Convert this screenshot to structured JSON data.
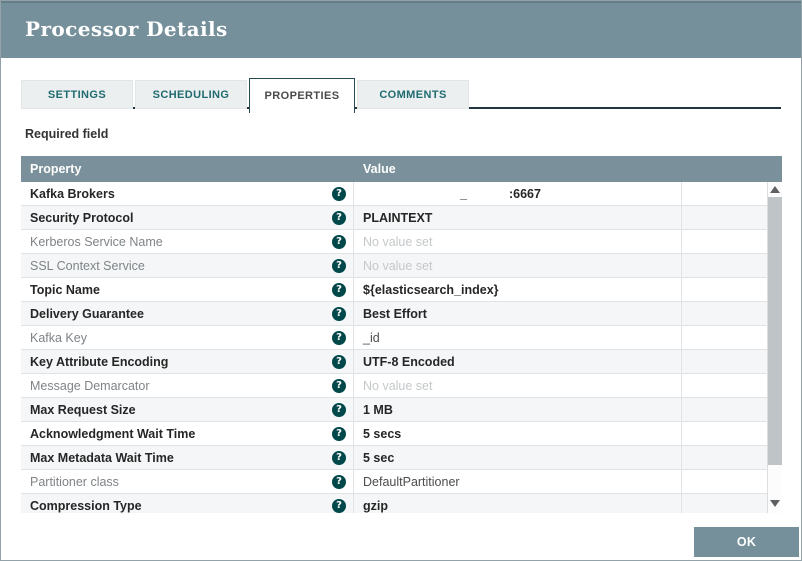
{
  "dialog": {
    "title": "Processor Details"
  },
  "tabs": [
    {
      "label": "SETTINGS",
      "active": false
    },
    {
      "label": "SCHEDULING",
      "active": false
    },
    {
      "label": "PROPERTIES",
      "active": true
    },
    {
      "label": "COMMENTS",
      "active": false
    }
  ],
  "required_field_label": "Required field",
  "ok_button_label": "OK",
  "help_icon_glyph": "?",
  "colors": {
    "header_slate": "#75909b",
    "dark_teal_icon": "#004849",
    "tab_teal_text": "#1f6b70",
    "tab_underline": "#22353e",
    "row_stripe": "#f4f6f7",
    "no_value_text": "#c5c8ca"
  },
  "table": {
    "columns": [
      "Property",
      "Value"
    ],
    "rows": [
      {
        "property": "Kafka Brokers",
        "required": true,
        "redacted": true,
        "redacted_fragment": "_",
        "value": ":6667"
      },
      {
        "property": "Security Protocol",
        "required": true,
        "value": "PLAINTEXT",
        "no_value": false
      },
      {
        "property": "Kerberos Service Name",
        "required": false,
        "value": "No value set",
        "no_value": true
      },
      {
        "property": "SSL Context Service",
        "required": false,
        "value": "No value set",
        "no_value": true
      },
      {
        "property": "Topic Name",
        "required": true,
        "value": "${elasticsearch_index}",
        "no_value": false
      },
      {
        "property": "Delivery Guarantee",
        "required": true,
        "value": "Best Effort",
        "no_value": false
      },
      {
        "property": "Kafka Key",
        "required": false,
        "value": "_id",
        "no_value": false
      },
      {
        "property": "Key Attribute Encoding",
        "required": true,
        "value": "UTF-8 Encoded",
        "no_value": false
      },
      {
        "property": "Message Demarcator",
        "required": false,
        "value": "No value set",
        "no_value": true
      },
      {
        "property": "Max Request Size",
        "required": true,
        "value": "1 MB",
        "no_value": false
      },
      {
        "property": "Acknowledgment Wait Time",
        "required": true,
        "value": "5 secs",
        "no_value": false
      },
      {
        "property": "Max Metadata Wait Time",
        "required": true,
        "value": "5 sec",
        "no_value": false
      },
      {
        "property": "Partitioner class",
        "required": false,
        "value": "DefaultPartitioner",
        "no_value": false
      },
      {
        "property": "Compression Type",
        "required": true,
        "value": "gzip",
        "no_value": false
      }
    ]
  }
}
